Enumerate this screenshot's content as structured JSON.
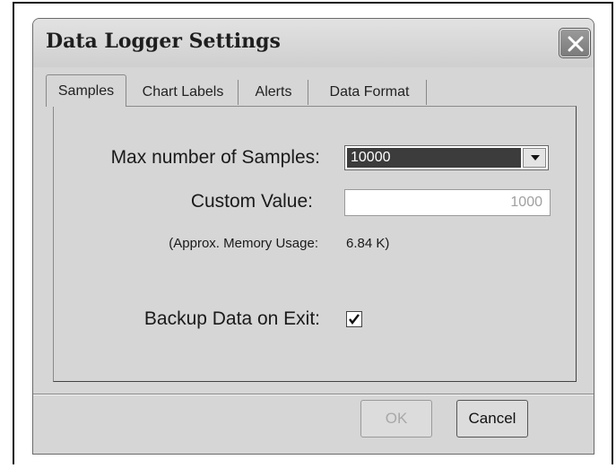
{
  "window": {
    "title": "Data Logger Settings"
  },
  "tabs": [
    {
      "label": "Samples",
      "active": true
    },
    {
      "label": "Chart Labels",
      "active": false
    },
    {
      "label": "Alerts",
      "active": false
    },
    {
      "label": "Data Format",
      "active": false
    }
  ],
  "samples": {
    "max_label": "Max number of Samples:",
    "max_value": "10000",
    "custom_label": "Custom Value:",
    "custom_value": "1000",
    "memory_label": "(Approx. Memory Usage:",
    "memory_value": "6.84 K)",
    "backup_label": "Backup Data on Exit:",
    "backup_checked": true
  },
  "buttons": {
    "ok": "OK",
    "cancel": "Cancel"
  },
  "icons": {
    "close": "close-icon",
    "dropdown": "chevron-down-icon",
    "check": "checkmark-icon"
  }
}
